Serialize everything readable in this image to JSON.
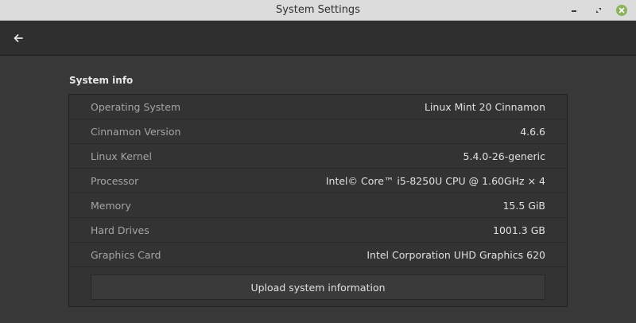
{
  "window": {
    "title": "System Settings"
  },
  "section": {
    "title": "System info"
  },
  "info_rows": [
    {
      "label": "Operating System",
      "value": "Linux Mint 20 Cinnamon"
    },
    {
      "label": "Cinnamon Version",
      "value": "4.6.6"
    },
    {
      "label": "Linux Kernel",
      "value": "5.4.0-26-generic"
    },
    {
      "label": "Processor",
      "value": "Intel© Core™ i5-8250U CPU @ 1.60GHz × 4"
    },
    {
      "label": "Memory",
      "value": "15.5 GiB"
    },
    {
      "label": "Hard Drives",
      "value": "1001.3 GB"
    },
    {
      "label": "Graphics Card",
      "value": "Intel Corporation UHD Graphics 620"
    }
  ],
  "upload_button": {
    "label": "Upload system information"
  },
  "icons": {
    "back": "arrow-left-icon",
    "minimize": "minimize-icon",
    "maximize": "maximize-icon",
    "close": "close-icon"
  },
  "colors": {
    "close_button": "#8cb25c",
    "background": "#383838",
    "titlebar": "#dcdcdc"
  }
}
